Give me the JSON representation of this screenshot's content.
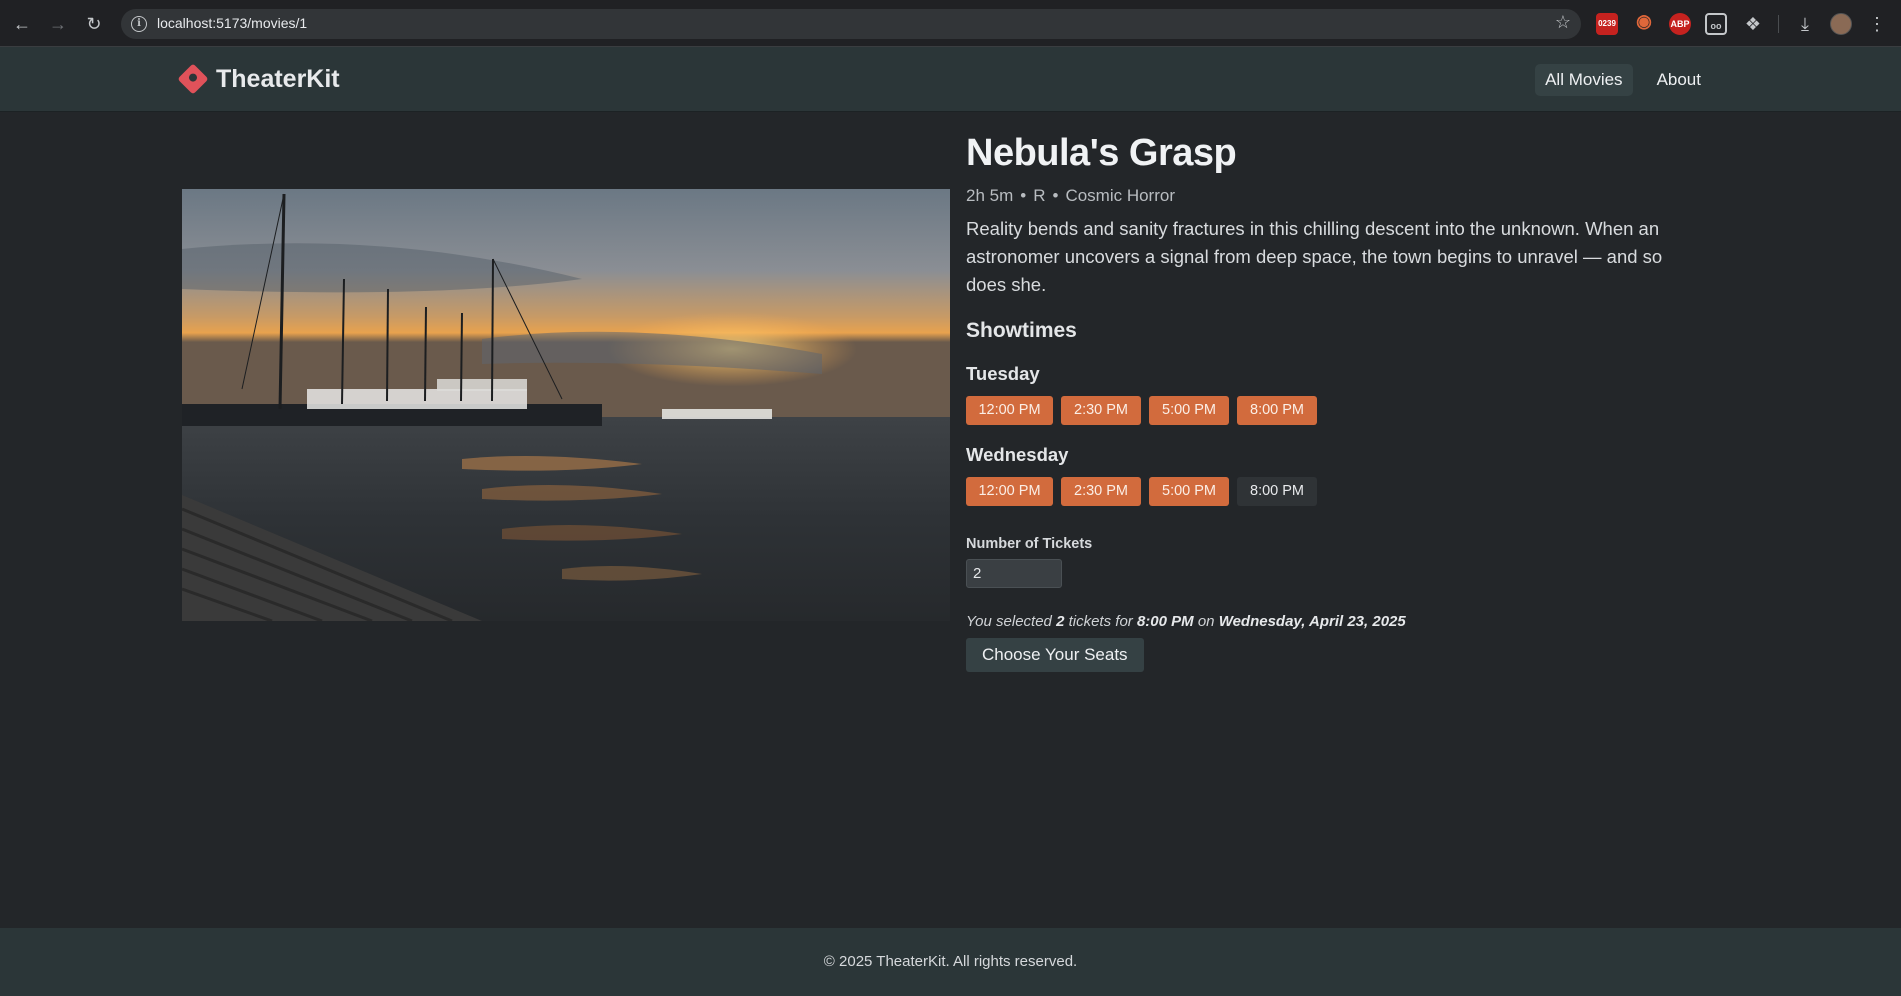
{
  "browser": {
    "url": "localhost:5173/movies/1",
    "extension_badge": "0239",
    "abp_label": "ABP"
  },
  "app": {
    "brand": "TheaterKit",
    "nav": [
      {
        "label": "All Movies",
        "active": true
      },
      {
        "label": "About",
        "active": false
      }
    ]
  },
  "movie": {
    "title": "Nebula's Grasp",
    "duration": "2h 5m",
    "rating": "R",
    "genre": "Cosmic Horror",
    "separator": "•",
    "description": "Reality bends and sanity fractures in this chilling descent into the unknown. When an astronomer uncovers a signal from deep space, the town begins to unravel — and so does she."
  },
  "showtimes": {
    "heading": "Showtimes",
    "days": [
      {
        "day": "Tuesday",
        "times": [
          "12:00 PM",
          "2:30 PM",
          "5:00 PM",
          "8:00 PM"
        ],
        "selected_index": null
      },
      {
        "day": "Wednesday",
        "times": [
          "12:00 PM",
          "2:30 PM",
          "5:00 PM",
          "8:00 PM"
        ],
        "selected_index": 3
      }
    ]
  },
  "tickets": {
    "label": "Number of Tickets",
    "value": "2"
  },
  "summary": {
    "prefix": "You selected",
    "count": "2",
    "mid1": "tickets for",
    "time": "8:00 PM",
    "mid2": "on",
    "date": "Wednesday, April 23, 2025"
  },
  "actions": {
    "choose_seats": "Choose Your Seats"
  },
  "footer": {
    "text": "© 2025 TheaterKit. All rights reserved."
  },
  "colors": {
    "accent": "#d26b3d",
    "background": "#232629",
    "header": "#2b3638",
    "brand_mark": "#e0525a"
  },
  "icons": [
    "back-arrow-icon",
    "forward-arrow-icon",
    "reload-icon",
    "site-info-icon",
    "bookmark-star-icon",
    "download-icon",
    "extensions-puzzle-icon",
    "menu-kebab-icon",
    "ticket-logo-icon"
  ]
}
